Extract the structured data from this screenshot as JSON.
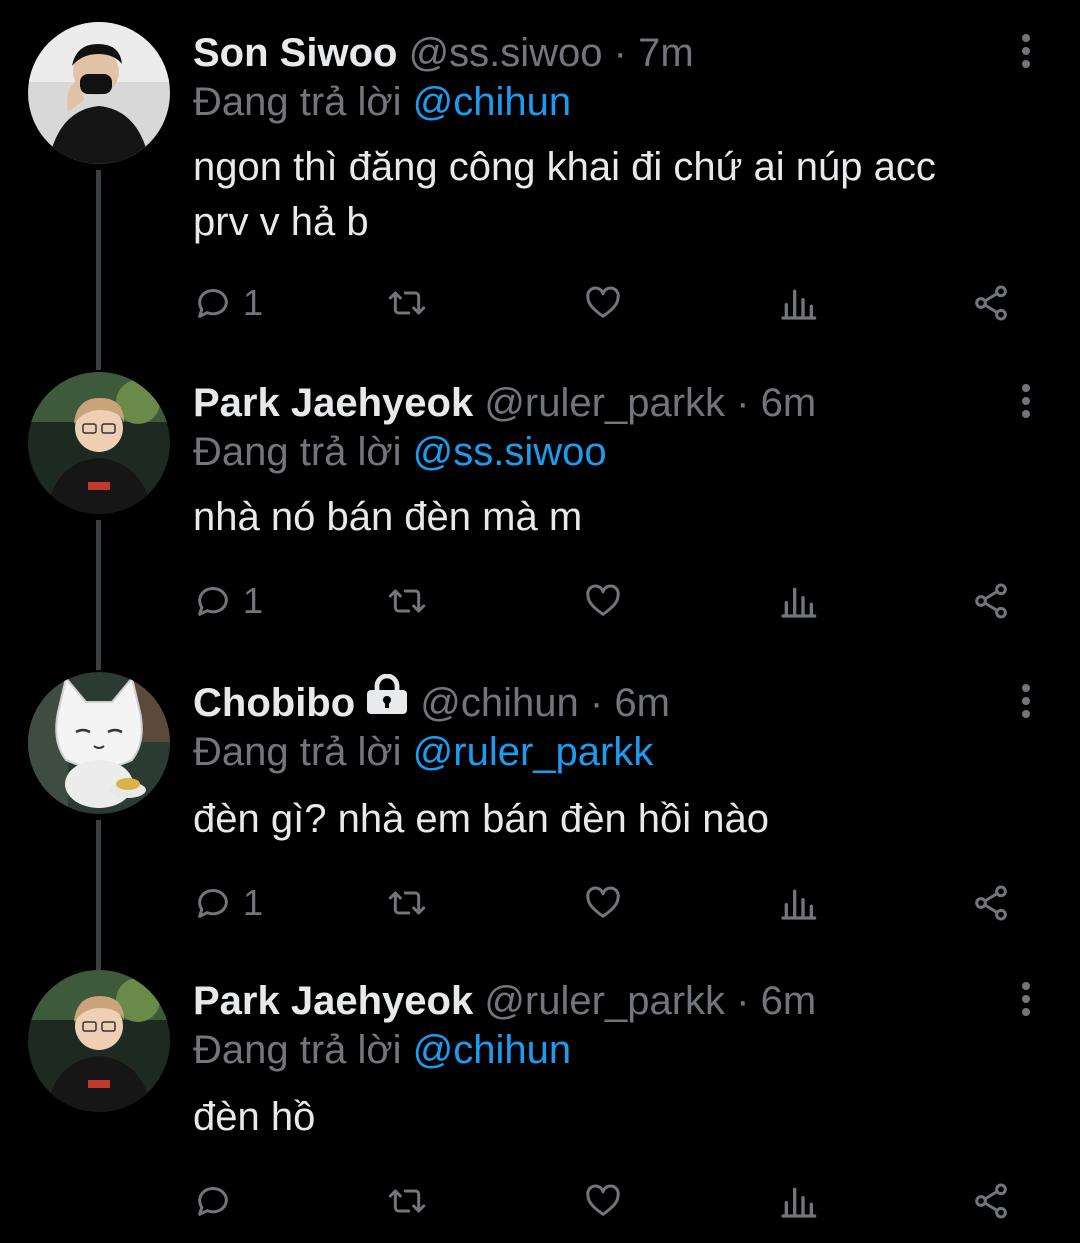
{
  "reply_prefix": "Đang trả lời",
  "colors": {
    "background": "#000000",
    "text": "#e7e9ea",
    "muted": "#71767b",
    "mention": "#1d9bf0",
    "line": "#3c4043"
  },
  "tweets": [
    {
      "name": "Son Siwoo",
      "handle": "@ss.siwoo",
      "sep": "·",
      "time": "7m",
      "reply_to": "@chihun",
      "text_lines": [
        "ngon thì đăng công khai đi chứ ai núp acc",
        "prv v hả b"
      ],
      "reply_count": "1",
      "locked": false
    },
    {
      "name": "Park Jaehyeok",
      "handle": "@ruler_parkk",
      "sep": "·",
      "time": "6m",
      "reply_to": "@ss.siwoo",
      "text_lines": [
        "nhà nó bán đèn mà m"
      ],
      "reply_count": "1",
      "locked": false
    },
    {
      "name": "Chobibo",
      "handle": "@chihun",
      "sep": "·",
      "time": "6m",
      "reply_to": "@ruler_parkk",
      "text_lines": [
        "đèn gì? nhà em bán đèn hồi nào"
      ],
      "reply_count": "1",
      "locked": true
    },
    {
      "name": "Park Jaehyeok",
      "handle": "@ruler_parkk",
      "sep": "·",
      "time": "6m",
      "reply_to": "@chihun",
      "text_lines": [
        "đèn hồ"
      ],
      "reply_count": "",
      "locked": false
    }
  ],
  "icons": [
    "reply-icon",
    "retweet-icon",
    "like-icon",
    "views-icon",
    "share-icon",
    "more-icon",
    "lock-icon"
  ]
}
